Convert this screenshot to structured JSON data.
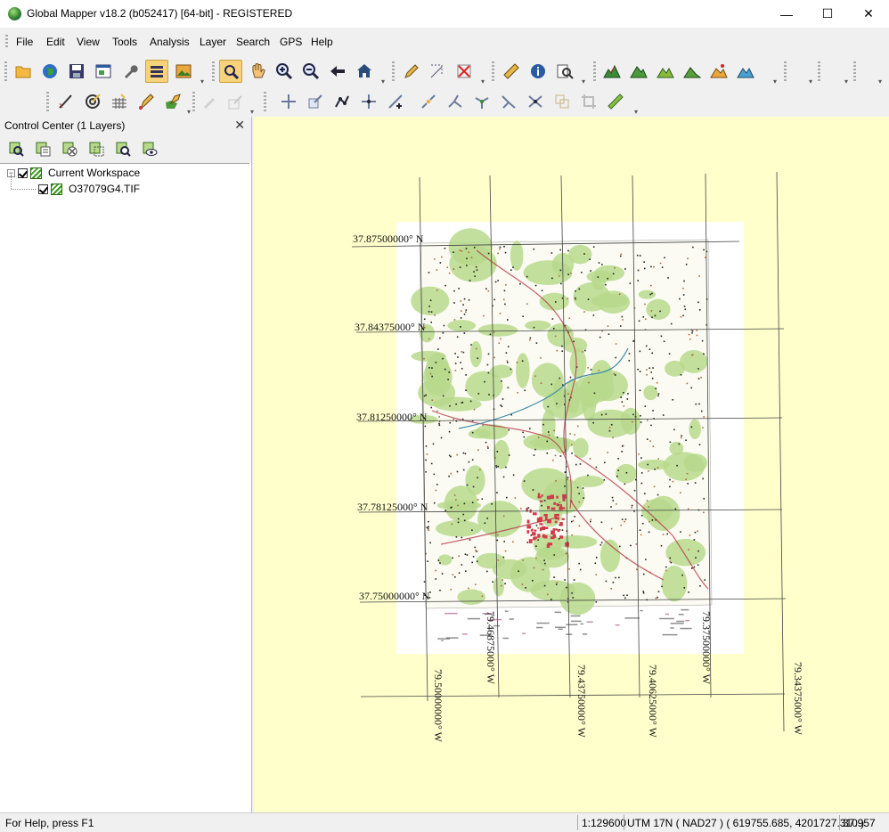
{
  "window": {
    "title": "Global Mapper v18.2 (b052417) [64-bit] - REGISTERED"
  },
  "menu": [
    "File",
    "Edit",
    "View",
    "Tools",
    "Analysis",
    "Layer",
    "Search",
    "GPS",
    "Help"
  ],
  "control_center": {
    "title": "Control Center (1 Layers)",
    "tree": [
      {
        "label": "Current Workspace"
      },
      {
        "label": "O37079G4.TIF"
      }
    ]
  },
  "map": {
    "lat_labels": [
      "37.87500000° N",
      "37.84375000° N",
      "37.81250000° N",
      "37.78125000° N",
      "37.75000000° N"
    ],
    "lon_labels": [
      "79.50000000° W",
      "79.46875000° W",
      "79.43750000° W",
      "79.40625000° W",
      "79.37500000° W",
      "79.34375000° W"
    ],
    "colors": {
      "background": "#ffffcc",
      "vegetation": "#b7d98c",
      "grid": "#444444",
      "contour": "#b06a3a",
      "urban": "#d23a4a"
    }
  },
  "status": {
    "help": "For Help, press F1",
    "scale": "1:129600",
    "projection": "UTM 17N ( NAD27 ) ( 619755.685, 4201727.310 )",
    "coord": "37.957"
  },
  "icons": {
    "toolbar1": [
      "open-folder-icon",
      "globe-icon",
      "save-icon",
      "configure-icon",
      "wrench-icon",
      "layers-icon",
      "image-icon",
      "zoom-tool-icon",
      "pan-hand-icon",
      "zoom-in-icon",
      "zoom-out-icon",
      "back-arrow-icon",
      "home-icon",
      "digitizer-icon",
      "select-area-icon",
      "delete-icon",
      "measure-icon",
      "info-icon",
      "search-icon",
      "terrain-1-icon",
      "terrain-2-icon",
      "terrain-3-icon",
      "terrain-4-icon",
      "terrain-5-icon",
      "terrain-6-icon"
    ],
    "toolbar2": [
      "edit-line-icon",
      "target-icon",
      "grid-draw-icon",
      "draw-point-icon",
      "draw-area-icon",
      "pencil-disabled-icon",
      "pencil-2-disabled-icon",
      "move-icon",
      "scale-icon",
      "vertex-icon",
      "move-vertex-icon",
      "insert-vertex-icon",
      "split-line-icon",
      "split-2-icon",
      "node-icon",
      "join-icon",
      "node-2-icon",
      "copy-icon",
      "crop-icon",
      "ruler-icon"
    ],
    "panel_tools": [
      "zoom-layer-icon",
      "options-icon",
      "remove-layer-icon",
      "copy-layer-icon",
      "find-icon",
      "view-icon"
    ]
  }
}
